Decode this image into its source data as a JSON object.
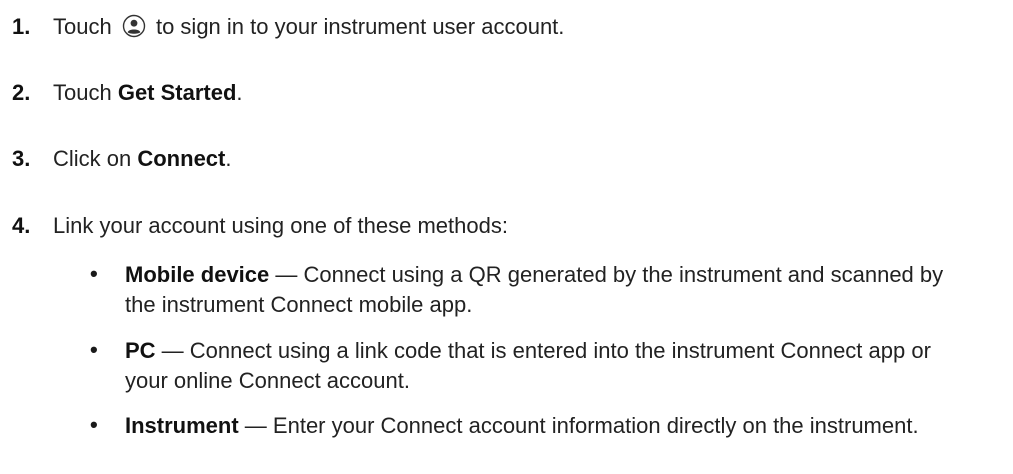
{
  "steps": [
    {
      "number": "1.",
      "before": "Touch",
      "icon": "user-account-icon",
      "after": "to sign in to your instrument user account."
    },
    {
      "number": "2.",
      "before": "Touch ",
      "bold": "Get Started",
      "after": "."
    },
    {
      "number": "3.",
      "before": "Click on ",
      "bold": "Connect",
      "after": "."
    },
    {
      "number": "4.",
      "text": "Link your account using one of these methods:"
    }
  ],
  "methods": [
    {
      "bullet": "•",
      "name": "Mobile device",
      "separator": " — ",
      "description": "Connect using a QR generated by the instrument and scanned by the instrument Connect mobile app."
    },
    {
      "bullet": "•",
      "name": "PC",
      "separator": " — ",
      "description": "Connect using a link code that is entered into the instrument Connect app or your online Connect account."
    },
    {
      "bullet": "•",
      "name": "Instrument",
      "separator": " — ",
      "description": "Enter your Connect account information directly on the instrument."
    }
  ]
}
